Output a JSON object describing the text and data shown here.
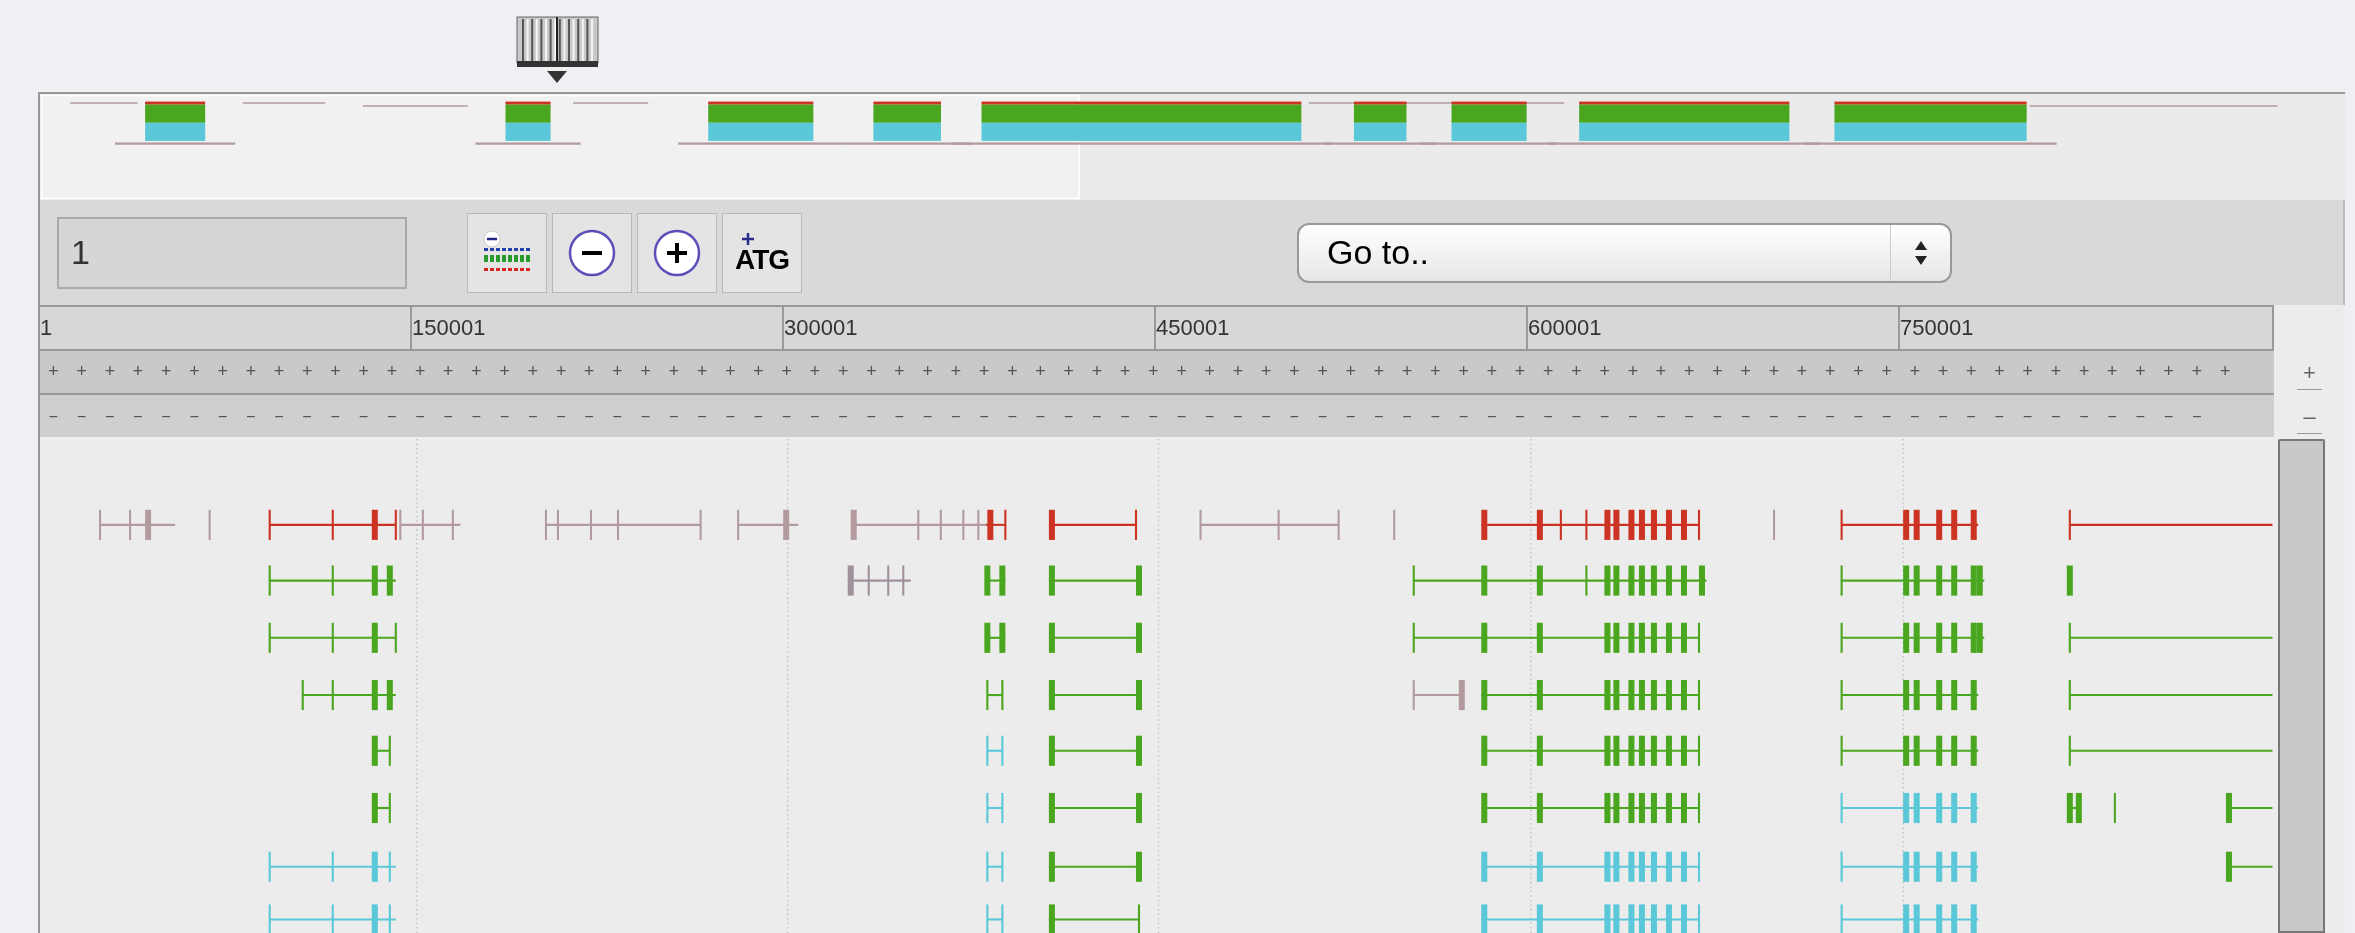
{
  "toolbar": {
    "position_field": {
      "value": "1"
    },
    "buttons": [
      {
        "kind": "density"
      },
      {
        "kind": "zoom_out"
      },
      {
        "kind": "zoom_in"
      },
      {
        "kind": "sequence",
        "label": "ATG"
      }
    ],
    "goto_select": {
      "value": "Go to.."
    }
  },
  "ruler": {
    "labels": [
      "1",
      "150001",
      "300001",
      "450001",
      "600001",
      "750001"
    ]
  },
  "strand_rows": [
    {
      "kind": "plus",
      "marks": "+ + + + + + + + + + + + + + + + + + + + + + + + + + + + + + + + + + + + + + + + + + + + + + + + + + + + + + + + + + + + + + + + + + + + + + + + + + + + + +",
      "side": "+"
    },
    {
      "kind": "minus",
      "marks": "– – – – – – – – – – – – – – – – – – – – – – – – – – – – – – – – – – – – – – – – – – – – – – – – – – – – – – – – – – – – – – – – – – – – – – – – – – – – –",
      "side": "–"
    }
  ]
}
